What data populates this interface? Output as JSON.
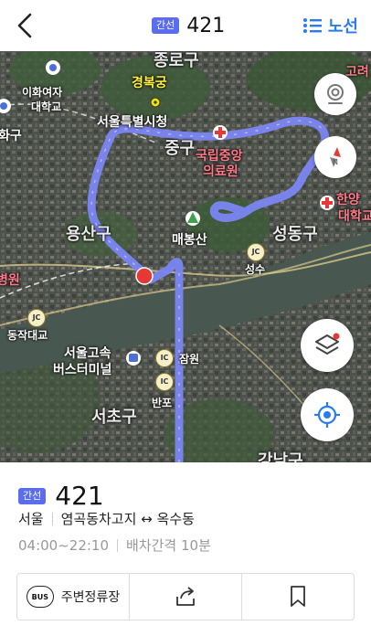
{
  "header": {
    "badge": "간선",
    "route_number": "421",
    "route_link_label": "노선"
  },
  "map": {
    "labels": {
      "jongno": "종로구",
      "gyeongbokgung": "경복궁",
      "ewha": "이화여자",
      "ewha2": "대학교",
      "seoul_cityhall": "서울특별시청",
      "junggu": "중구",
      "nmc": "국립중앙",
      "nmc2": "의료원",
      "yongsan": "용산구",
      "maebongsan": "매봉산",
      "seongdong": "성동구",
      "hanyang": "한양",
      "hanyang2": "대학교",
      "seongsu": "성수",
      "hospital": "병원",
      "dongjak": "동작대교",
      "express": "서울고속",
      "express2": "버스터미널",
      "jamwon": "잠원",
      "banpo": "반포",
      "seocho": "서초구",
      "gangnam": "강남구",
      "hwagu": "화구",
      "goryeo": "고려",
      "mapo": "대학교"
    },
    "ic": "IC",
    "jc": "JC"
  },
  "info": {
    "badge": "간선",
    "route_number": "421",
    "region": "서울",
    "endpoints": "염곡동차고지 ↔ 옥수동",
    "hours": "04:00~22:10",
    "interval": "배차간격 10분"
  },
  "actions": {
    "nearby_stops": "주변정류장",
    "bus_icon_text": "BUS"
  },
  "colors": {
    "accent": "#2b7bf0",
    "badge": "#5a6cf0",
    "route_line": "#7b86f2",
    "location_marker": "#e53935"
  }
}
